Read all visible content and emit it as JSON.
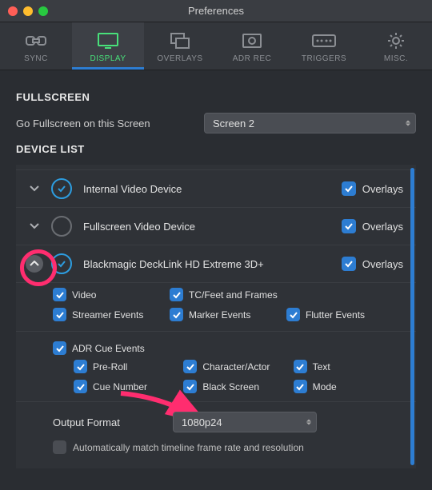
{
  "window": {
    "title": "Preferences"
  },
  "tabs": {
    "sync": "SYNC",
    "display": "DISPLAY",
    "overlays": "OVERLAYS",
    "adr_rec": "ADR REC",
    "triggers": "TRIGGERS",
    "misc": "MISC."
  },
  "sections": {
    "fullscreen_title": "FULLSCREEN",
    "go_fullscreen_label": "Go Fullscreen on this Screen",
    "screen_select": "Screen 2",
    "device_list_title": "DEVICE LIST"
  },
  "devices": [
    {
      "name": "Internal Video Device",
      "enabled": true,
      "overlays_label": "Overlays"
    },
    {
      "name": "Fullscreen Video Device",
      "enabled": false,
      "overlays_label": "Overlays"
    },
    {
      "name": "Blackmagic DeckLink HD Extreme 3D+",
      "enabled": true,
      "overlays_label": "Overlays"
    }
  ],
  "device_options": {
    "video": "Video",
    "tc_feet": "TC/Feet and Frames",
    "streamer": "Streamer Events",
    "marker": "Marker Events",
    "flutter": "Flutter Events",
    "adr_cue": "ADR Cue Events",
    "preroll": "Pre-Roll",
    "char_actor": "Character/Actor",
    "text": "Text",
    "cue_num": "Cue Number",
    "black": "Black Screen",
    "mode": "Mode"
  },
  "output": {
    "label": "Output Format",
    "value": "1080p24",
    "auto_match": "Automatically match timeline frame rate and resolution"
  }
}
